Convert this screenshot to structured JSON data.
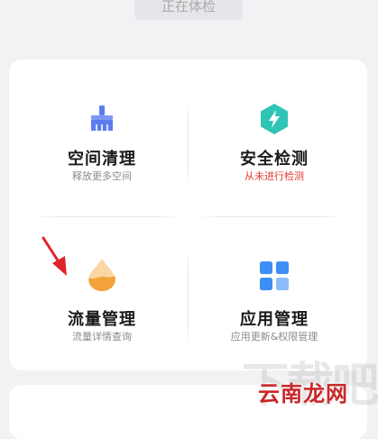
{
  "header": {
    "checkup_button": "正在体检"
  },
  "tiles": [
    {
      "title": "空间清理",
      "subtitle": "释放更多空间",
      "icon": "broom-icon"
    },
    {
      "title": "安全检测",
      "subtitle": "从未进行检测",
      "icon": "shield-bolt-icon"
    },
    {
      "title": "流量管理",
      "subtitle": "流量详情查询",
      "icon": "water-drop-icon"
    },
    {
      "title": "应用管理",
      "subtitle": "应用更新&权限管理",
      "icon": "app-grid-icon"
    }
  ],
  "watermark": {
    "text": "云南龙网",
    "faint": "下载吧"
  },
  "colors": {
    "background": "#f2f2f4",
    "card": "#ffffff",
    "broom": "#5b7cf0",
    "shield": "#2ec4b6",
    "drop": "#f4a23c",
    "grid": "#3d8ef5",
    "warning": "#e23b2e",
    "arrow": "#e0242c",
    "watermark": "#c8282a"
  }
}
